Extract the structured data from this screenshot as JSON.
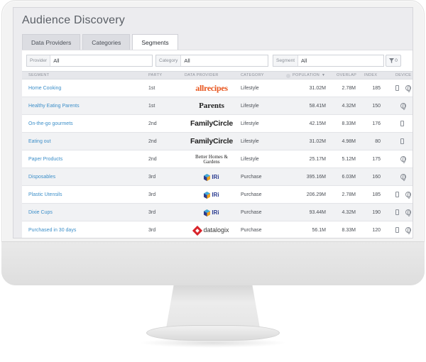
{
  "app": {
    "title": "Audience Discovery"
  },
  "tabs": [
    {
      "label": "Data Providers",
      "active": false
    },
    {
      "label": "Categories",
      "active": false
    },
    {
      "label": "Segments",
      "active": true
    }
  ],
  "filters": {
    "provider": {
      "label": "Provider",
      "value": "All"
    },
    "category": {
      "label": "Category",
      "value": "All"
    },
    "segment": {
      "label": "Segment",
      "value": "All"
    },
    "filter_count": "0"
  },
  "columns": {
    "segment": "SEGMENT",
    "party": "PARTY",
    "provider": "DATA PROVIDER",
    "category": "CATEGORY",
    "population": "POPULATION",
    "overlap": "OVERLAP",
    "index": "INDEX",
    "device": "DEVICE"
  },
  "rows": [
    {
      "segment": "Home Cooking",
      "party": "1st",
      "provider": "allrecipes",
      "provider_text": "allrecipes",
      "category": "Lifestyle",
      "population": "31.02M",
      "overlap": "2.78M",
      "index": "185",
      "devices": [
        "phone",
        "globe"
      ]
    },
    {
      "segment": "Healthy Eating Parents",
      "party": "1st",
      "provider": "parents",
      "provider_text": "Parents",
      "category": "Lifestyle",
      "population": "58.41M",
      "overlap": "4.32M",
      "index": "150",
      "devices": [
        "globe"
      ]
    },
    {
      "segment": "On-the-go gourmets",
      "party": "2nd",
      "provider": "familycircle",
      "provider_text": "FamilyCircle",
      "category": "Lifestyle",
      "population": "42.15M",
      "overlap": "8.33M",
      "index": "176",
      "devices": [
        "phone"
      ]
    },
    {
      "segment": "Eating out",
      "party": "2nd",
      "provider": "familycircle",
      "provider_text": "FamilyCircle",
      "category": "Lifestyle",
      "population": "31.02M",
      "overlap": "4.98M",
      "index": "80",
      "devices": [
        "phone"
      ]
    },
    {
      "segment": "Paper Products",
      "party": "2nd",
      "provider": "bhg",
      "provider_text": "Better Homes & Gardens",
      "category": "Lifestyle",
      "population": "25.17M",
      "overlap": "5.12M",
      "index": "175",
      "devices": [
        "globe"
      ]
    },
    {
      "segment": "Disposables",
      "party": "3rd",
      "provider": "iri",
      "provider_text": "IRi",
      "category": "Purchase",
      "population": "395.16M",
      "overlap": "6.03M",
      "index": "160",
      "devices": [
        "globe"
      ]
    },
    {
      "segment": "Plastic Utensils",
      "party": "3rd",
      "provider": "iri",
      "provider_text": "IRi",
      "category": "Purchase",
      "population": "206.29M",
      "overlap": "2.78M",
      "index": "185",
      "devices": [
        "phone",
        "globe"
      ]
    },
    {
      "segment": "Dixie Cups",
      "party": "3rd",
      "provider": "iri",
      "provider_text": "IRi",
      "category": "Purchase",
      "population": "93.44M",
      "overlap": "4.32M",
      "index": "190",
      "devices": [
        "phone",
        "globe"
      ]
    },
    {
      "segment": "Purchased in 30 days",
      "party": "3rd",
      "provider": "datalogix",
      "provider_text": "datalogix",
      "category": "Purchase",
      "population": "56.1M",
      "overlap": "8.33M",
      "index": "120",
      "devices": [
        "phone",
        "globe"
      ]
    }
  ]
}
